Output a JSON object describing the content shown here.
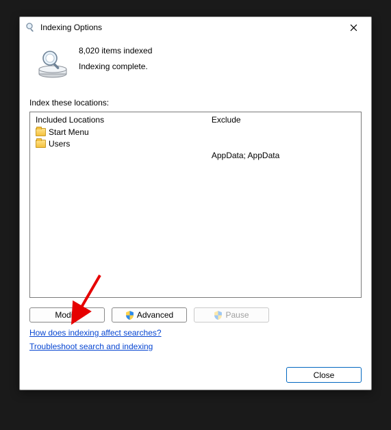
{
  "title": "Indexing Options",
  "status": {
    "count_line": "8,020 items indexed",
    "state_line": "Indexing complete."
  },
  "section_label": "Index these locations:",
  "columns": {
    "included": "Included Locations",
    "exclude": "Exclude"
  },
  "locations": [
    {
      "name": "Start Menu",
      "exclude": ""
    },
    {
      "name": "Users",
      "exclude": "AppData; AppData"
    }
  ],
  "buttons": {
    "modify": "Modify",
    "advanced": "Advanced",
    "pause": "Pause",
    "close": "Close"
  },
  "links": {
    "how": "How does indexing affect searches?",
    "troubleshoot": "Troubleshoot search and indexing"
  }
}
